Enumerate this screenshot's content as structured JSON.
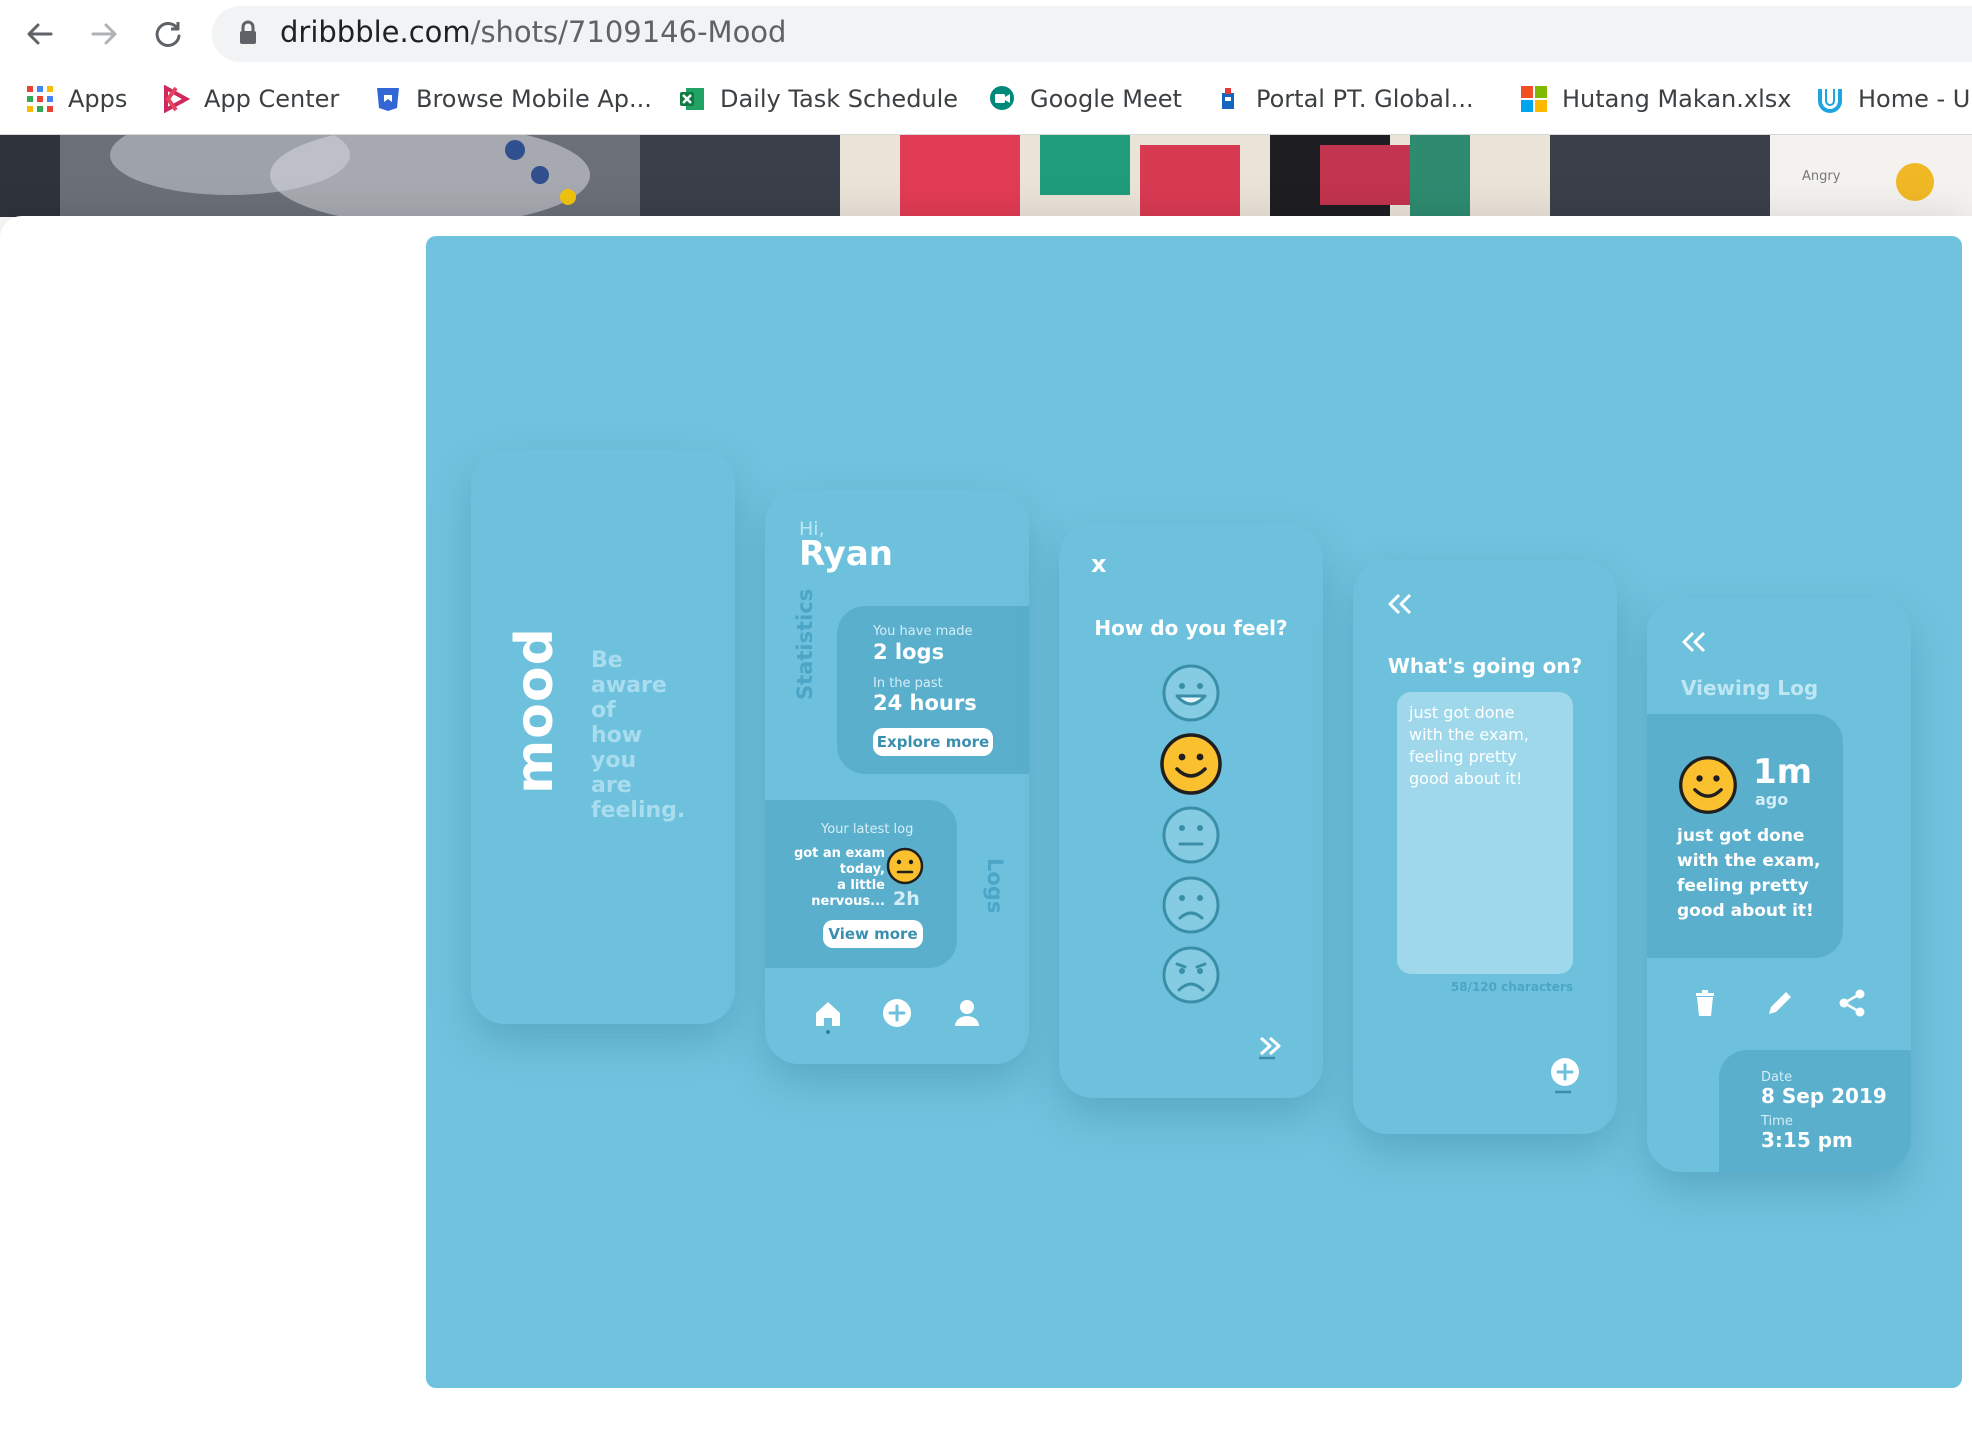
{
  "browser": {
    "url_domain": "dribbble.com",
    "url_path": "/shots/7109146-Mood",
    "bookmarks": [
      {
        "label": "Apps",
        "icon": "apps-grid-icon"
      },
      {
        "label": "App Center",
        "icon": "app-center-icon"
      },
      {
        "label": "Browse Mobile Ap...",
        "icon": "bookmark-shield-icon"
      },
      {
        "label": "Daily Task Schedule",
        "icon": "excel-icon"
      },
      {
        "label": "Google Meet",
        "icon": "google-meet-icon"
      },
      {
        "label": "Portal PT. Global...",
        "icon": "portal-icon"
      },
      {
        "label": "Hutang Makan.xlsx",
        "icon": "microsoft-icon"
      },
      {
        "label": "Home - U",
        "icon": "udemy-icon"
      }
    ]
  },
  "strip": {
    "angry_label": "Angry"
  },
  "shot": {
    "splash": {
      "logo": "mood",
      "lines": [
        "Be",
        "aware",
        "of",
        "how",
        "you",
        "are",
        "feeling."
      ]
    },
    "home": {
      "greeting": "Hi,",
      "name": "Ryan",
      "stats_tab": "Statistics",
      "made_label": "You have made",
      "logs_count": "2 logs",
      "past_label": "In the past",
      "hours": "24 hours",
      "explore": "Explore more",
      "latest_label": "Your latest log",
      "latest_lines": [
        "got an exam",
        "today,",
        "a little",
        "nervous..."
      ],
      "latest_time": "2h",
      "view_more": "View more",
      "logs_tab": "Logs"
    },
    "feel": {
      "close": "x",
      "question": "How do you feel?",
      "moods": [
        "very-happy",
        "happy",
        "neutral",
        "sad",
        "very-sad"
      ],
      "selected_mood": "happy"
    },
    "going": {
      "question": "What's going on?",
      "entry_lines": [
        "just got done",
        "with the exam,",
        "feeling pretty",
        "good about it!"
      ],
      "char_count": "58/120 characters"
    },
    "view": {
      "title": "Viewing Log",
      "time_value": "1m",
      "time_unit": "ago",
      "entry_lines": [
        "just got done",
        "with the exam,",
        "feeling pretty",
        "good about it!"
      ],
      "date_label": "Date",
      "date_value": "8 Sep 2019",
      "time_label": "Time",
      "time_text": "3:15 pm"
    }
  },
  "colors": {
    "background": "#70c3de",
    "card": "#6ec1dc",
    "panel": "#5aafcd",
    "happy_face": "#fbc02d"
  }
}
